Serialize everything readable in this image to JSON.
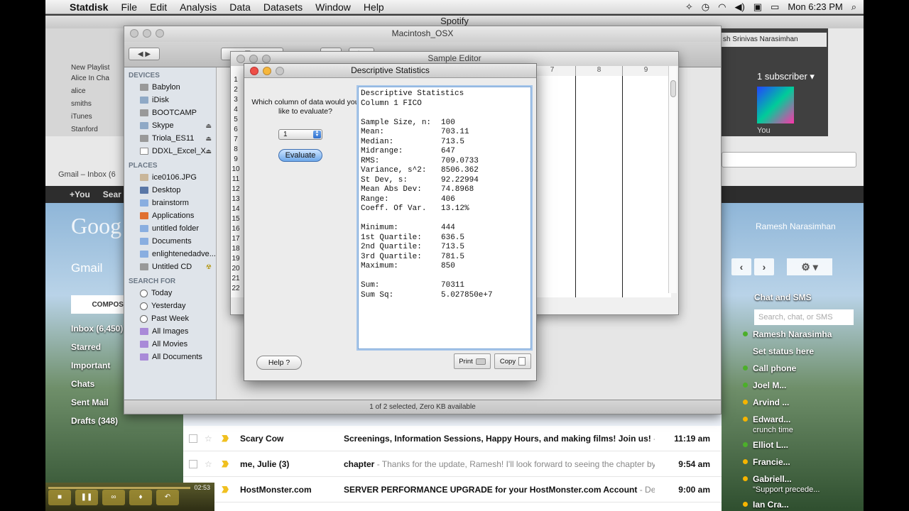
{
  "menubar": {
    "app_name": "Statdisk",
    "menus": [
      "File",
      "Edit",
      "Analysis",
      "Data",
      "Datasets",
      "Window",
      "Help"
    ],
    "clock": "Mon 6:23 PM"
  },
  "spotify": {
    "window_title": "Spotify",
    "sidebar": [
      "New Playlist",
      "Alice In Cha",
      "alice",
      "smiths",
      "iTunes",
      "Stanford"
    ],
    "user_name": "sh Srinivas Narasimhan",
    "subscriber": "1 subscriber ▾",
    "you": "You"
  },
  "chrome": {
    "tab": "Gmail – Inbox (6"
  },
  "finder": {
    "window_title": "Macintosh_OSX",
    "devices_header": "DEVICES",
    "devices": [
      {
        "label": "Babylon",
        "eject": false
      },
      {
        "label": "iDisk",
        "eject": false
      },
      {
        "label": "BOOTCAMP",
        "eject": false
      },
      {
        "label": "Skype",
        "eject": true
      },
      {
        "label": "Triola_ES11",
        "eject": true
      },
      {
        "label": "DDXL_Excel_X",
        "eject": true
      }
    ],
    "places_header": "PLACES",
    "places": [
      "ice0106.JPG",
      "Desktop",
      "brainstorm",
      "Applications",
      "untitled folder",
      "Documents",
      "enlightenedadve...",
      "Untitled CD"
    ],
    "search_header": "SEARCH FOR",
    "search": [
      "Today",
      "Yesterday",
      "Past Week",
      "All Images",
      "All Movies",
      "All Documents"
    ],
    "status": "1 of 2 selected, Zero KB available"
  },
  "sample_editor": {
    "window_title": "Sample Editor",
    "columns": [
      "7",
      "8",
      "9"
    ],
    "rows": [
      "1",
      "2",
      "3",
      "4",
      "5",
      "6",
      "7",
      "8",
      "9",
      "10",
      "11",
      "12",
      "13",
      "14",
      "15",
      "16",
      "17",
      "18",
      "19",
      "20",
      "21",
      "22"
    ]
  },
  "descriptive": {
    "window_title": "Descriptive Statistics",
    "prompt": "Which column of data would you like to evaluate?",
    "selected_column": "1",
    "evaluate_label": "Evaluate",
    "help_label": "Help ?",
    "print_label": "Print",
    "copy_label": "Copy",
    "heading": "Descriptive Statistics",
    "subheading": "Column 1 FICO",
    "stats": [
      {
        "k": "Sample Size, n:",
        "v": "100"
      },
      {
        "k": "Mean:",
        "v": "703.11"
      },
      {
        "k": "Median:",
        "v": "713.5"
      },
      {
        "k": "Midrange:",
        "v": "647"
      },
      {
        "k": "RMS:",
        "v": "709.0733"
      },
      {
        "k": "Variance, s^2:",
        "v": "8506.362"
      },
      {
        "k": "St Dev, s:",
        "v": "92.22994"
      },
      {
        "k": "Mean Abs Dev:",
        "v": "74.8968"
      },
      {
        "k": "Range:",
        "v": "406"
      },
      {
        "k": "Coeff. Of Var.",
        "v": "13.12%"
      }
    ],
    "quartiles": [
      {
        "k": "Minimum:",
        "v": "444"
      },
      {
        "k": "1st Quartile:",
        "v": "636.5"
      },
      {
        "k": "2nd Quartile:",
        "v": "713.5"
      },
      {
        "k": "3rd Quartile:",
        "v": "781.5"
      },
      {
        "k": "Maximum:",
        "v": "850"
      }
    ],
    "sums": [
      {
        "k": "Sum:",
        "v": "70311"
      },
      {
        "k": "Sum Sq:",
        "v": "5.027850e+7"
      }
    ]
  },
  "gmail": {
    "top_links": [
      "+You",
      "Sear"
    ],
    "logo": "Goog",
    "title": "Gmail",
    "compose": "COMPOSE",
    "nav": [
      "Inbox (6,450)",
      "Starred",
      "Important",
      "Chats",
      "Sent Mail",
      "Drafts (348)"
    ],
    "account": "Ramesh Narasimhan",
    "chat_header": "Chat and SMS",
    "search_placeholder": "Search, chat, or SMS",
    "chat": [
      {
        "name": "Ramesh Narasimha",
        "sub": "",
        "color": "#4caf2a"
      },
      {
        "name": "Set status here",
        "sub": "",
        "color": ""
      },
      {
        "name": "Call phone",
        "sub": "",
        "color": "#4caf2a"
      },
      {
        "name": "Joel M...",
        "sub": "",
        "color": "#4caf2a"
      },
      {
        "name": "Arvind ...",
        "sub": "",
        "color": "#f5b400"
      },
      {
        "name": "Edward...",
        "sub": "crunch time",
        "color": "#f5b400"
      },
      {
        "name": "Elliot L...",
        "sub": "",
        "color": "#4caf2a"
      },
      {
        "name": "Francie...",
        "sub": "",
        "color": "#f5b400"
      },
      {
        "name": "Gabriell...",
        "sub": "\"Support precede...",
        "color": "#f5b400"
      },
      {
        "name": "Ian Cra...",
        "sub": "",
        "color": "#f5b400"
      }
    ],
    "messages": [
      {
        "from": "Scary Cow",
        "subject": "Screenings, Information Sessions, Happy Hours, and making films! Join us!",
        "snippet": " -",
        "time": "11:19 am"
      },
      {
        "from": "me, Julie (3)",
        "subject": "chapter",
        "snippet": " - Thanks for the update, Ramesh! I'll look forward to seeing the chapter by t",
        "time": "9:54 am"
      },
      {
        "from": "HostMonster.com",
        "subject": "SERVER PERFORMANCE UPGRADE for your HostMonster.com Account",
        "snippet": " - Dea",
        "time": "9:00 am"
      }
    ]
  },
  "media": {
    "time": "02:53"
  }
}
